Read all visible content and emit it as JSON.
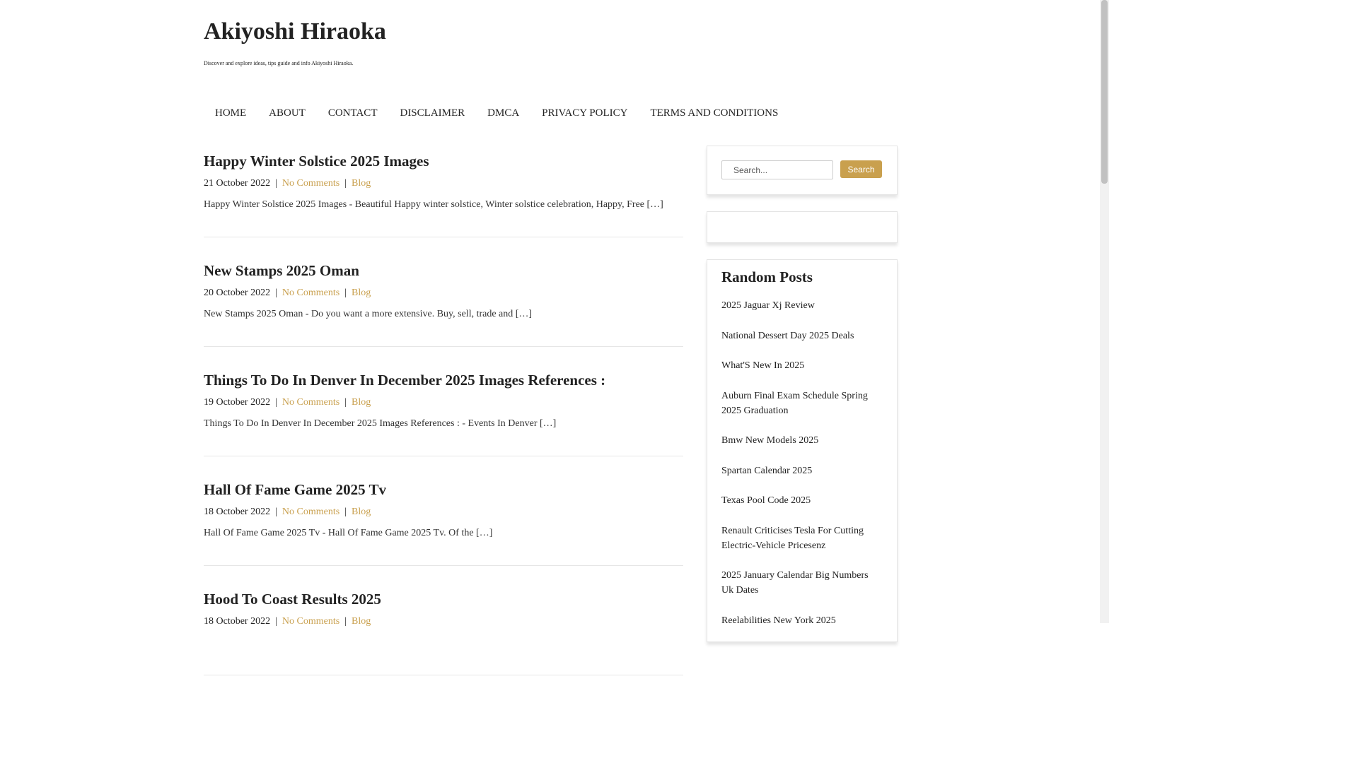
{
  "site": {
    "title": "Akiyoshi Hiraoka",
    "tagline": "Discover and explore ideas, tips guide and info Akiyoshi Hiraoka."
  },
  "nav": [
    {
      "label": "HOME"
    },
    {
      "label": "ABOUT"
    },
    {
      "label": "CONTACT"
    },
    {
      "label": "DISCLAIMER"
    },
    {
      "label": "DMCA"
    },
    {
      "label": "PRIVACY POLICY"
    },
    {
      "label": "TERMS AND CONDITIONS"
    }
  ],
  "posts": [
    {
      "title": "Happy Winter Solstice 2025 Images",
      "date": "21 October 2022",
      "comments": "No Comments",
      "category": "Blog",
      "excerpt": "Happy Winter Solstice 2025 Images - Beautiful Happy winter solstice, Winter solstice celebration, Happy, Free […]"
    },
    {
      "title": "New Stamps 2025 Oman",
      "date": "20 October 2022",
      "comments": "No Comments",
      "category": "Blog",
      "excerpt": "New Stamps 2025 Oman - Do you want a more extensive. Buy, sell, trade and […]"
    },
    {
      "title": "Things To Do In Denver In December 2025 Images References :",
      "date": "19 October 2022",
      "comments": "No Comments",
      "category": "Blog",
      "excerpt": "Things To Do In Denver In December 2025 Images References : - Events In Denver […]"
    },
    {
      "title": "Hall Of Fame Game 2025 Tv",
      "date": "18 October 2022",
      "comments": "No Comments",
      "category": "Blog",
      "excerpt": "Hall Of Fame Game 2025 Tv - Hall Of Fame Game 2025 Tv. Of the […]"
    },
    {
      "title": "Hood To Coast Results 2025",
      "date": "18 October 2022",
      "comments": "No Comments",
      "category": "Blog",
      "excerpt": ""
    }
  ],
  "sidebar": {
    "search": {
      "placeholder": "Search...",
      "button_label": "Search"
    },
    "random_posts": {
      "title": "Random Posts",
      "items": [
        "2025 Jaguar Xj Review",
        "National Dessert Day 2025 Deals",
        "What'S New In 2025",
        "Auburn Final Exam Schedule Spring 2025 Graduation",
        "Bmw New Models 2025",
        "Spartan Calendar 2025",
        "Texas Pool Code 2025",
        "Renault Criticises Tesla For Cutting Electric-Vehicle Pricesenz",
        "2025 January Calendar Big Numbers Uk Dates",
        "Reelabilities New York 2025"
      ]
    }
  },
  "colors": {
    "accent": "#c9a04e",
    "text": "#222222",
    "divider": "#e6e6e6"
  }
}
